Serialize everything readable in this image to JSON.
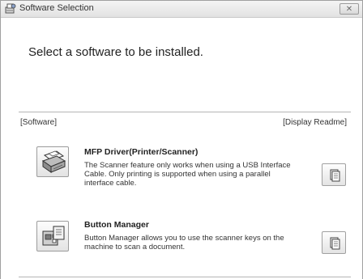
{
  "window": {
    "title": "Software Selection",
    "close_label": "✕",
    "icon": "software-install-icon"
  },
  "heading": "Select a software to be installed.",
  "columns": {
    "software": "[Software]",
    "readme": "[Display Readme]"
  },
  "items": [
    {
      "title": "MFP Driver(Printer/Scanner)",
      "desc_lines": [
        "The Scanner feature only works when using a USB Interface",
        "Cable. Only printing is supported when using a parallel",
        "interface cable."
      ],
      "icon": "printer-scanner-icon",
      "readme_icon": "readme-document-icon"
    },
    {
      "title": "Button Manager",
      "desc_lines": [
        "Button Manager allows you to use the scanner keys on the",
        "machine to scan a document."
      ],
      "icon": "button-manager-icon",
      "readme_icon": "readme-document-icon"
    }
  ]
}
